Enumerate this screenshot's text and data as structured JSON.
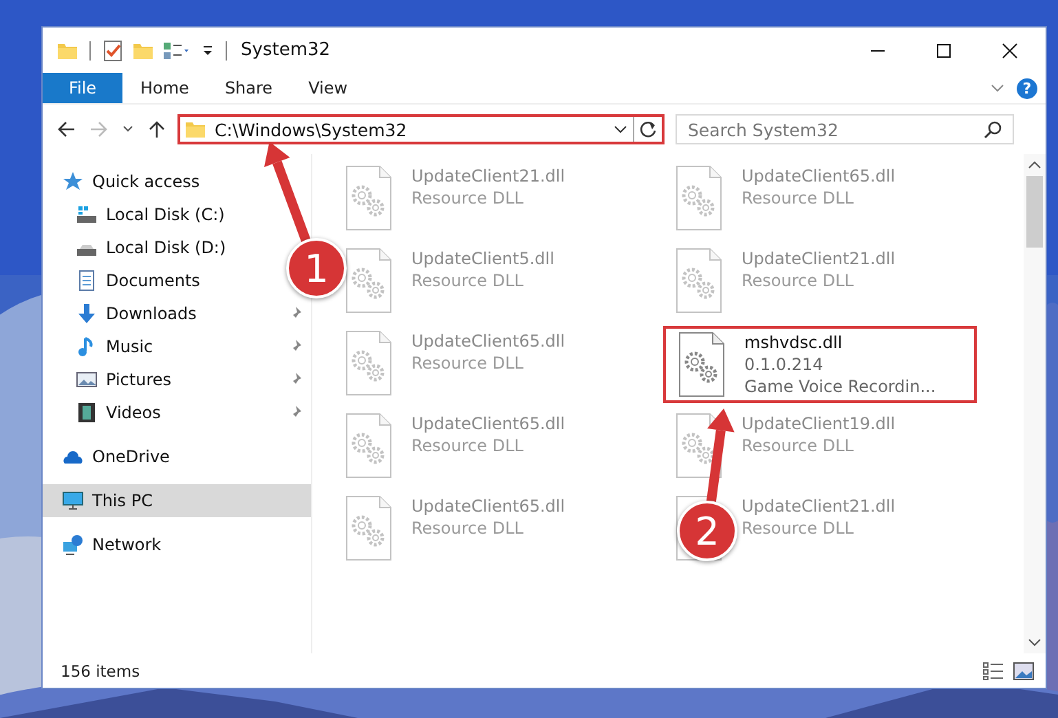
{
  "window": {
    "title": "System32"
  },
  "ribbon": {
    "tabs": [
      {
        "label": "File",
        "kind": "file",
        "selected": false
      },
      {
        "label": "Home",
        "kind": "tab",
        "selected": false
      },
      {
        "label": "Share",
        "kind": "tab",
        "selected": false
      },
      {
        "label": "View",
        "kind": "tab",
        "selected": false
      }
    ],
    "help": "?"
  },
  "address_bar": {
    "path": "C:\\Windows\\System32",
    "highlighted": true
  },
  "search": {
    "placeholder": "Search System32"
  },
  "navigation": [
    {
      "label": "Quick access",
      "kind": "star",
      "selected": false,
      "children": [
        {
          "label": "Local Disk (C:)",
          "kind": "system-drive",
          "pinned": false,
          "selected": false
        },
        {
          "label": "Local Disk (D:)",
          "kind": "drive",
          "pinned": false,
          "selected": false
        },
        {
          "label": "Documents",
          "kind": "document",
          "pinned": false,
          "selected": false
        },
        {
          "label": "Downloads",
          "kind": "download",
          "pinned": true,
          "selected": false
        },
        {
          "label": "Music",
          "kind": "music",
          "pinned": true,
          "selected": false
        },
        {
          "label": "Pictures",
          "kind": "pictures",
          "pinned": true,
          "selected": false
        },
        {
          "label": "Videos",
          "kind": "video",
          "pinned": true,
          "selected": false
        }
      ]
    },
    {
      "label": "OneDrive",
      "kind": "cloud",
      "selected": false
    },
    {
      "label": "This PC",
      "kind": "computer",
      "selected": true
    },
    {
      "label": "Network",
      "kind": "network",
      "selected": false
    }
  ],
  "files": [
    {
      "name": "UpdateClient21.dll",
      "description": "Resource DLL",
      "dimmed": true,
      "highlighted": false
    },
    {
      "name": "UpdateClient65.dll",
      "description": "Resource DLL",
      "dimmed": true,
      "highlighted": false
    },
    {
      "name": "UpdateClient5.dll",
      "description": "Resource DLL",
      "dimmed": true,
      "highlighted": false
    },
    {
      "name": "UpdateClient21.dll",
      "description": "Resource DLL",
      "dimmed": true,
      "highlighted": false
    },
    {
      "name": "UpdateClient65.dll",
      "description": "Resource DLL",
      "dimmed": true,
      "highlighted": false
    },
    {
      "name": "mshvdsc.dll",
      "version": "0.1.0.214",
      "description": "Game Voice Recordin...",
      "dimmed": false,
      "highlighted": true
    },
    {
      "name": "UpdateClient65.dll",
      "description": "Resource DLL",
      "dimmed": true,
      "highlighted": false
    },
    {
      "name": "UpdateClient19.dll",
      "description": "Resource DLL",
      "dimmed": true,
      "highlighted": false
    },
    {
      "name": "UpdateClient65.dll",
      "description": "Resource DLL",
      "dimmed": true,
      "highlighted": false
    },
    {
      "name": "UpdateClient21.dll",
      "description": "Resource DLL",
      "dimmed": true,
      "highlighted": false
    }
  ],
  "status_bar": {
    "item_count": "156 items"
  },
  "annotations": [
    {
      "number": "1"
    },
    {
      "number": "2"
    }
  ]
}
